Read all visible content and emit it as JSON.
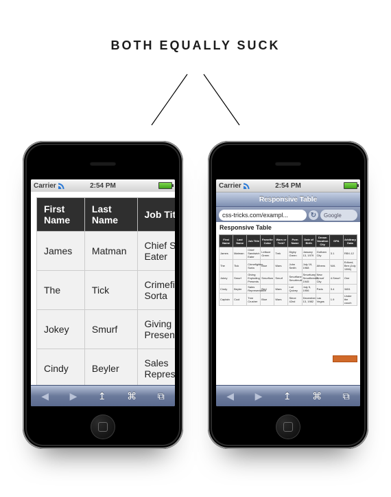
{
  "headline": "BOTH EQUALLY SUCK",
  "status": {
    "carrier": "Carrier",
    "time": "2:54 PM"
  },
  "right_phone": {
    "nav_title": "Responsive Table",
    "url": "css-tricks.com/exampl...",
    "reload_glyph": "↻",
    "search_placeholder": "Google",
    "page_title": "Responsive Table"
  },
  "toolbar": {
    "back": "◀",
    "fwd": "▶",
    "share": "↥",
    "bookmarks": "⌘",
    "pages": "⧉"
  },
  "table": {
    "headers": [
      "First Name",
      "Last Name",
      "Job Title",
      "Favorite Color",
      "Wars or Trek?",
      "Porn Name",
      "Date of Birth",
      "Dream Vacation City",
      "GPA",
      "Arbitrary Data"
    ],
    "rows": [
      [
        "James",
        "Matman",
        "Chief Sandwich Eater",
        "Lettuce Green",
        "Trek",
        "Digby Green",
        "January 13, 1979",
        "Gotham City",
        "3.1",
        "RBX-12"
      ],
      [
        "The",
        "Tick",
        "Crimefighter Sorta",
        "Blue",
        "Wars",
        "John Smith",
        "July 19, 1968",
        "Athens",
        "N/A",
        "Edlund, Ben (July 1996)"
      ],
      [
        "Jokey",
        "Smurf",
        "Giving Exploding Presents",
        "Smurflow",
        "Smurf",
        "Smurflane Smurfmutt",
        "Smurfuary Smurfteenth, 1945",
        "New Smurf City",
        "4.Smurf",
        "One"
      ],
      [
        "Cindy",
        "Beyler",
        "Sales Representative",
        "Red",
        "Wars",
        "Lori Quivey",
        "July 5, 1956",
        "Paris",
        "3.4",
        "3451"
      ],
      [
        "Captain",
        "Cool",
        "Tree Crusher",
        "Blue",
        "Wars",
        "Steve 42nd",
        "December 13, 1982",
        "Las Vegas",
        "1.9",
        "Under the couch"
      ]
    ]
  }
}
